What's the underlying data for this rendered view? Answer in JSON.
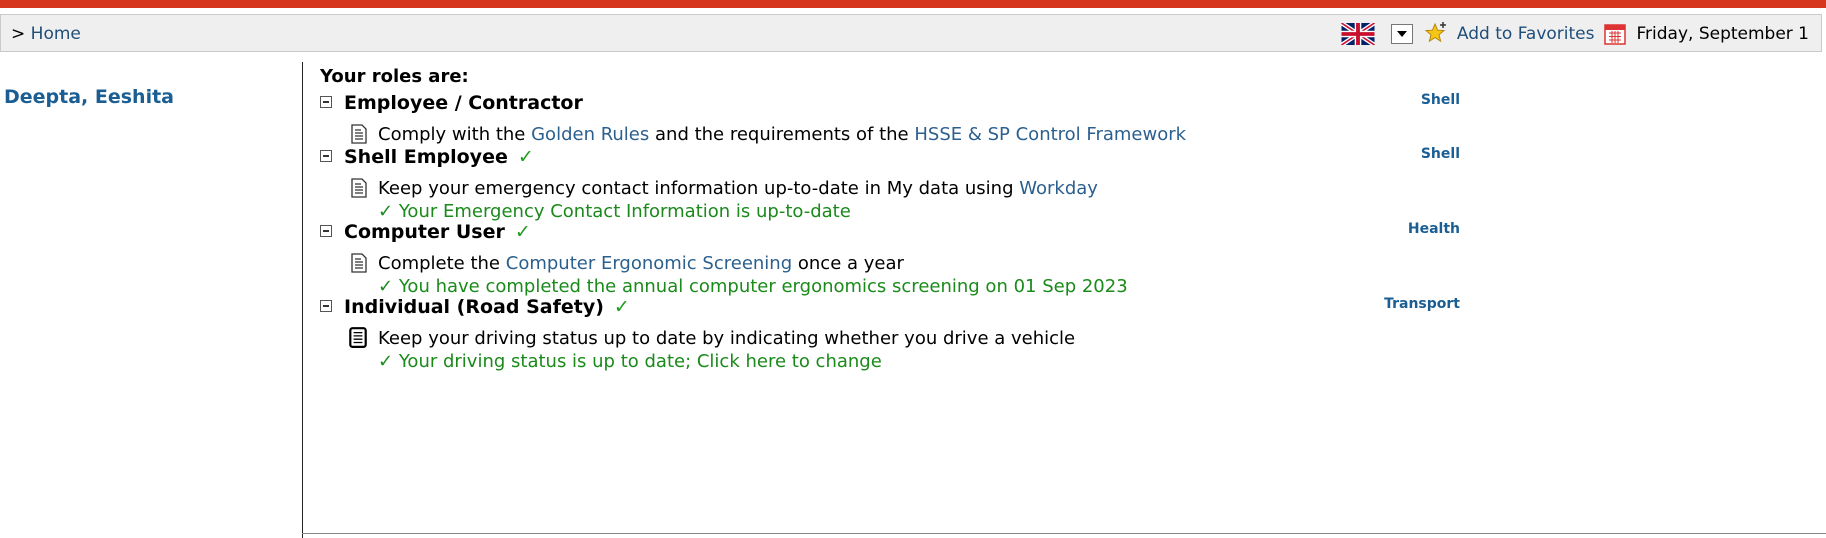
{
  "colors": {
    "accent_bar": "#d7361e",
    "link": "#1f4e79",
    "ok_green": "#1a8a1a",
    "user_name": "#1a5e93"
  },
  "breadcrumb": {
    "separator": ">",
    "home": "Home"
  },
  "header": {
    "language_icon": "uk-flag-icon",
    "favorites_label": "Add to Favorites",
    "date": "Friday, September 1"
  },
  "user": {
    "name": "Deepta, Eeshita"
  },
  "roles_title": "Your roles are:",
  "roles": [
    {
      "name": "Employee / Contractor",
      "check": "",
      "category": "Shell",
      "task": {
        "prefix": "Comply with the",
        "link1": "Golden Rules",
        "middle": "and the requirements of the",
        "link2": "HSSE & SP Control Framework"
      },
      "status": ""
    },
    {
      "name": "Shell Employee",
      "check": "✓",
      "category": "Shell",
      "task": {
        "prefix": "Keep your emergency contact information up-to-date in My data using",
        "link1": "Workday"
      },
      "status": "Your Emergency Contact Information is up-to-date"
    },
    {
      "name": "Computer User",
      "check": "✓",
      "category": "Health",
      "task": {
        "prefix": "Complete the",
        "link1": "Computer Ergonomic Screening",
        "suffix": "once a year"
      },
      "status": "You have completed the annual computer ergonomics screening on 01 Sep 2023"
    },
    {
      "name": "Individual (Road Safety)",
      "check": "✓",
      "category": "Transport",
      "task": {
        "prefix": "Keep your driving status up to date by indicating whether you drive a vehicle"
      },
      "status": "Your driving status is up to date; Click here to change"
    }
  ]
}
